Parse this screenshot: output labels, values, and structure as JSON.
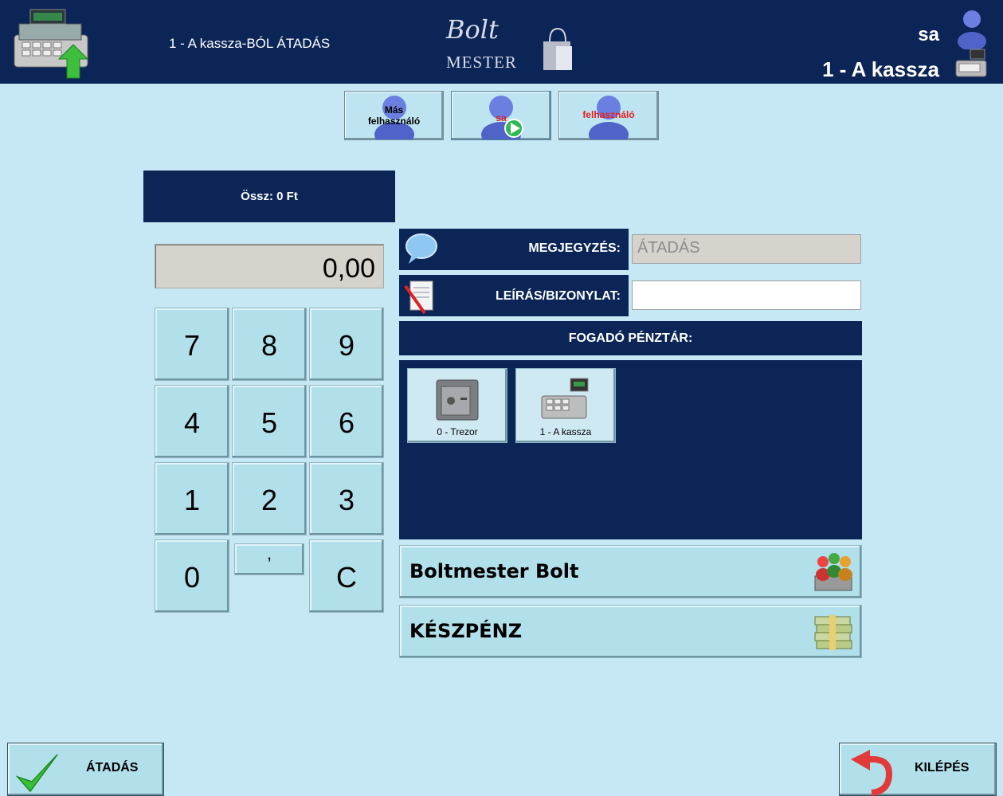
{
  "header": {
    "title": "1 - A kassza-BÓL ÁTADÁS",
    "logo_top": "Bolt",
    "logo_bottom": "MESTER",
    "user_name": "sa",
    "register_name": "1 - A kassza"
  },
  "user_buttons": [
    {
      "label": "Más\nfelhasználó",
      "label_line1": "Más",
      "label_line2": "felhasználó"
    },
    {
      "label": "sa"
    },
    {
      "label": "felhasználó"
    }
  ],
  "total": "Össz: 0 Ft",
  "amount": "0,00",
  "keypad": {
    "k7": "7",
    "k8": "8",
    "k9": "9",
    "k4": "4",
    "k5": "5",
    "k6": "6",
    "k1": "1",
    "k2": "2",
    "k3": "3",
    "k0": "0",
    "comma": ",",
    "clear": "C"
  },
  "note": {
    "label": "MEGJEGYZÉS:",
    "value": "ÁTADÁS"
  },
  "description": {
    "label": "LEÍRÁS/BIZONYLAT:",
    "value": ""
  },
  "receiving": {
    "label": "FOGADÓ PÉNZTÁR:",
    "registers": [
      {
        "label": "0 - Trezor",
        "icon": "safe-icon"
      },
      {
        "label": "1 - A kassza",
        "icon": "cash-register-icon"
      }
    ]
  },
  "shop_button": "Boltmester Bolt",
  "payment_button": "KÉSZPÉNZ",
  "footer": {
    "transfer": "ÁTADÁS",
    "exit": "KILÉPÉS"
  },
  "colors": {
    "navy": "#0b2557",
    "background": "#c5e8f4",
    "button": "#b1dfea",
    "red_text": "#e02020"
  }
}
